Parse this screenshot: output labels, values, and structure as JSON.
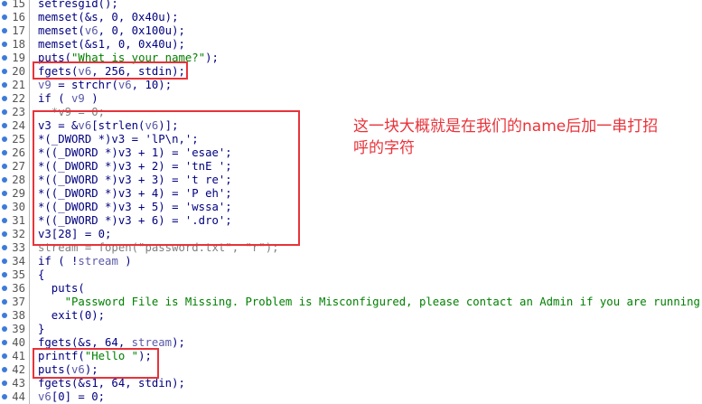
{
  "code_lines": [
    {
      "n": "15",
      "tokens": [
        {
          "t": "setresgid();",
          "c": "plain"
        }
      ]
    },
    {
      "n": "16",
      "tokens": [
        {
          "t": "memset(&s, 0, 0x40u);",
          "c": "plain"
        }
      ]
    },
    {
      "n": "17",
      "tokens": [
        {
          "t": "memset(",
          "c": "plain"
        },
        {
          "t": "v6",
          "c": "var"
        },
        {
          "t": ", 0, 0x100u);",
          "c": "plain"
        }
      ]
    },
    {
      "n": "18",
      "tokens": [
        {
          "t": "memset(&s1, 0, 0x40u);",
          "c": "plain"
        }
      ]
    },
    {
      "n": "19",
      "tokens": [
        {
          "t": "puts(",
          "c": "plain"
        },
        {
          "t": "\"What is your name?\"",
          "c": "str"
        },
        {
          "t": ");",
          "c": "plain"
        }
      ]
    },
    {
      "n": "20",
      "tokens": [
        {
          "t": "fgets(",
          "c": "plain"
        },
        {
          "t": "v6",
          "c": "var"
        },
        {
          "t": ", 256, stdin);",
          "c": "plain"
        }
      ]
    },
    {
      "n": "21",
      "tokens": [
        {
          "t": "v9",
          "c": "var"
        },
        {
          "t": " = strchr(",
          "c": "plain"
        },
        {
          "t": "v6",
          "c": "var"
        },
        {
          "t": ", 10);",
          "c": "plain"
        }
      ]
    },
    {
      "n": "22",
      "tokens": [
        {
          "t": "if ( ",
          "c": "plain"
        },
        {
          "t": "v9",
          "c": "var"
        },
        {
          "t": " )",
          "c": "plain"
        }
      ]
    },
    {
      "n": "23",
      "tokens": [
        {
          "t": "  *v9 = 0;",
          "c": "grey"
        }
      ]
    },
    {
      "n": "24",
      "tokens": [
        {
          "t": "v3 = &",
          "c": "plain"
        },
        {
          "t": "v6",
          "c": "var"
        },
        {
          "t": "[strlen(",
          "c": "plain"
        },
        {
          "t": "v6",
          "c": "var"
        },
        {
          "t": ")];",
          "c": "plain"
        }
      ]
    },
    {
      "n": "25",
      "tokens": [
        {
          "t": "*(_DWORD *)v3 = 'lP\\n,';",
          "c": "plain"
        }
      ]
    },
    {
      "n": "26",
      "tokens": [
        {
          "t": "*((_DWORD *)v3 + 1) = 'esae';",
          "c": "plain"
        }
      ]
    },
    {
      "n": "27",
      "tokens": [
        {
          "t": "*((_DWORD *)v3 + 2) = 'tnE ';",
          "c": "plain"
        }
      ]
    },
    {
      "n": "28",
      "tokens": [
        {
          "t": "*((_DWORD *)v3 + 3) = 't re';",
          "c": "plain"
        }
      ]
    },
    {
      "n": "29",
      "tokens": [
        {
          "t": "*((_DWORD *)v3 + 4) = 'P eh';",
          "c": "plain"
        }
      ]
    },
    {
      "n": "30",
      "tokens": [
        {
          "t": "*((_DWORD *)v3 + 5) = 'wssa';",
          "c": "plain"
        }
      ]
    },
    {
      "n": "31",
      "tokens": [
        {
          "t": "*((_DWORD *)v3 + 6) = '.dro';",
          "c": "plain"
        }
      ]
    },
    {
      "n": "32",
      "tokens": [
        {
          "t": "v3[28] = 0;",
          "c": "plain"
        }
      ]
    },
    {
      "n": "33",
      "tokens": [
        {
          "t": "stream = fopen(\"password.txt\", \"r\");",
          "c": "grey"
        }
      ]
    },
    {
      "n": "34",
      "tokens": [
        {
          "t": "if ( !",
          "c": "plain"
        },
        {
          "t": "stream",
          "c": "var"
        },
        {
          "t": " )",
          "c": "plain"
        }
      ]
    },
    {
      "n": "35",
      "tokens": [
        {
          "t": "{",
          "c": "plain"
        }
      ]
    },
    {
      "n": "36",
      "tokens": [
        {
          "t": "  puts(",
          "c": "plain"
        }
      ]
    },
    {
      "n": "37",
      "tokens": [
        {
          "t": "    \"Password File is Missing. Problem is Misconfigured, please contact an Admin if you are running this",
          "c": "str"
        }
      ]
    },
    {
      "n": "38",
      "tokens": [
        {
          "t": "  exit(0);",
          "c": "plain"
        }
      ]
    },
    {
      "n": "39",
      "tokens": [
        {
          "t": "}",
          "c": "plain"
        }
      ]
    },
    {
      "n": "40",
      "tokens": [
        {
          "t": "fgets(&s, 64, ",
          "c": "plain"
        },
        {
          "t": "stream",
          "c": "var"
        },
        {
          "t": ");",
          "c": "plain"
        }
      ]
    },
    {
      "n": "41",
      "tokens": [
        {
          "t": "printf(",
          "c": "plain"
        },
        {
          "t": "\"Hello \"",
          "c": "str"
        },
        {
          "t": ");",
          "c": "plain"
        }
      ]
    },
    {
      "n": "42",
      "tokens": [
        {
          "t": "puts(",
          "c": "plain"
        },
        {
          "t": "v6",
          "c": "var"
        },
        {
          "t": ");",
          "c": "plain"
        }
      ]
    },
    {
      "n": "43",
      "tokens": [
        {
          "t": "fgets(&s1, 64, stdin);",
          "c": "plain"
        }
      ]
    },
    {
      "n": "44",
      "tokens": [
        {
          "t": "v6",
          "c": "var"
        },
        {
          "t": "[0] = 0;",
          "c": "plain"
        }
      ]
    }
  ],
  "annotation": {
    "line1": "这一块大概就是在我们的name后加一串打招",
    "line2": "呼的字符"
  },
  "colors": {
    "highlight_box": "#e8333a",
    "annotation_text": "#e8333a",
    "string": "#008000",
    "code": "#000080"
  }
}
